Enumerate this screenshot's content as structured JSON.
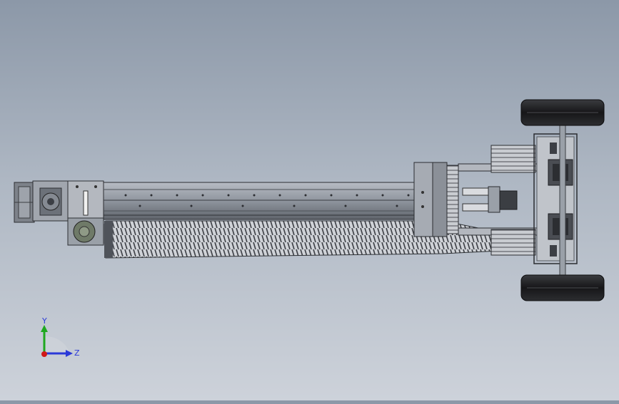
{
  "viewport": {
    "background_top": "#8c98a8",
    "background_bottom": "#cdd2da"
  },
  "triad": {
    "y_label": "Y",
    "z_label": "Z",
    "y_color": "#1fa81f",
    "z_color": "#2a39d8",
    "origin_color": "#d01818"
  },
  "model": {
    "frame_color": "#5d6168",
    "rail_color": "#8f959e",
    "motor_color": "#707b6a",
    "wheel_color": "#1a1a1c",
    "bellows_color": "#6a6d73"
  }
}
